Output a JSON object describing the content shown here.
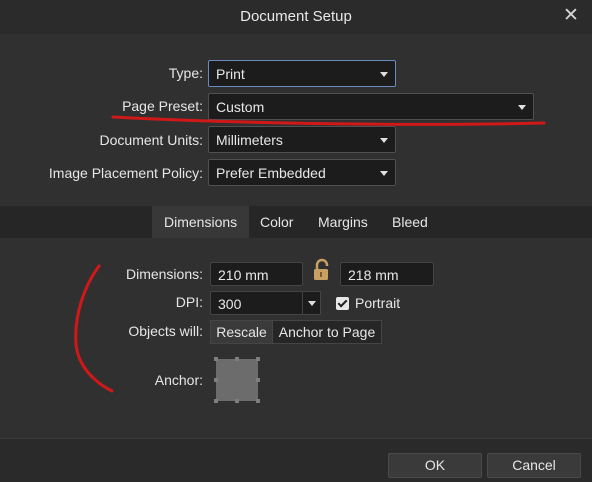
{
  "window": {
    "title": "Document Setup",
    "close_glyph": "✕"
  },
  "setup": {
    "type": {
      "label": "Type:",
      "value": "Print"
    },
    "page_preset": {
      "label": "Page Preset:",
      "value": "Custom"
    },
    "document_units": {
      "label": "Document Units:",
      "value": "Millimeters"
    },
    "image_placement": {
      "label": "Image Placement Policy:",
      "value": "Prefer Embedded"
    }
  },
  "tabs": [
    {
      "label": "Dimensions",
      "active": true
    },
    {
      "label": "Color",
      "active": false
    },
    {
      "label": "Margins",
      "active": false
    },
    {
      "label": "Bleed",
      "active": false
    }
  ],
  "dimensions": {
    "label": "Dimensions:",
    "width": "210 mm",
    "height": "218 mm",
    "lock_icon": "padlock-icon",
    "dpi_label": "DPI:",
    "dpi_value": "300",
    "portrait_label": "Portrait",
    "portrait_checked": true,
    "objects_label": "Objects will:",
    "objects_options": [
      "Rescale",
      "Anchor to Page"
    ],
    "objects_selected": "Rescale",
    "anchor_label": "Anchor:"
  },
  "footer": {
    "ok_label": "OK",
    "cancel_label": "Cancel"
  },
  "colors": {
    "annotation_red": "#d01818",
    "focus_border": "#6a8bbd"
  }
}
